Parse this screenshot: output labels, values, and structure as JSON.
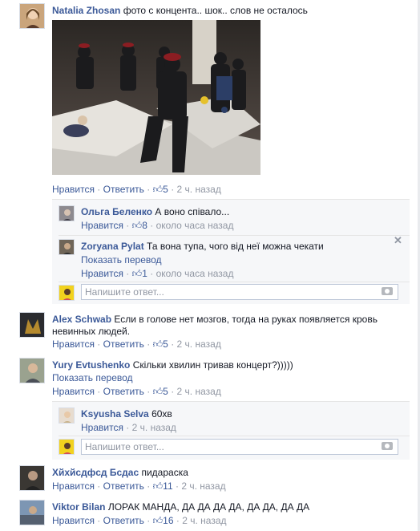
{
  "comments": [
    {
      "id": "c1",
      "author": "Natalia Zhosan",
      "text": "фото с концента.. шок.. слов не осталось",
      "actions": {
        "like": "Нравится",
        "reply": "Ответить",
        "likes": "5",
        "time": "2 ч. назад"
      },
      "replies": [
        {
          "author": "Ольга Беленко",
          "text": "А воно співало...",
          "actions": {
            "like": "Нравится",
            "likes": "8",
            "time": "около часа назад"
          }
        },
        {
          "author": "Zoryana Pylat",
          "text": "Та вона тупа, чого від неї можна чекати",
          "translate": "Показать перевод",
          "actions": {
            "like": "Нравится",
            "likes": "1",
            "time": "около часа назад"
          }
        }
      ],
      "reply_placeholder": "Напишите ответ..."
    },
    {
      "id": "c2",
      "author": "Alex Schwab",
      "text_line1": "Если в голове нет мозгов, тогда на руках появляется кровь",
      "text_line2": "невинных людей.",
      "actions": {
        "like": "Нравится",
        "reply": "Ответить",
        "likes": "5",
        "time": "2 ч. назад"
      }
    },
    {
      "id": "c3",
      "author": "Yury Evtushenko",
      "text": "Скільки хвилин тривав концерт?)))))",
      "translate": "Показать перевод",
      "actions": {
        "like": "Нравится",
        "reply": "Ответить",
        "likes": "5",
        "time": "2 ч. назад"
      },
      "replies": [
        {
          "author": "Ksyusha Selva",
          "text": "60хв",
          "actions": {
            "like": "Нравится",
            "time": "2 ч. назад"
          }
        }
      ],
      "reply_placeholder": "Напишите ответ..."
    },
    {
      "id": "c4",
      "author": "Хйхйсдфсд Бсдас",
      "text": "пидараска",
      "actions": {
        "like": "Нравится",
        "reply": "Ответить",
        "likes": "11",
        "time": "2 ч. назад"
      }
    },
    {
      "id": "c5",
      "author": "Viktor Bilan",
      "text": "ЛОРАК МАНДА, ДА ДА ДА ДА, ДА ДА, ДА ДА",
      "actions": {
        "like": "Нравится",
        "reply": "Ответить",
        "likes": "16",
        "time": "2 ч. назад"
      }
    }
  ],
  "icons": {
    "thumb": "thumbs-up-icon",
    "close": "close-icon",
    "camera": "camera-icon"
  },
  "colors": {
    "link": "#3b5998",
    "meta": "#9197a3",
    "panel": "#f6f7f9"
  }
}
